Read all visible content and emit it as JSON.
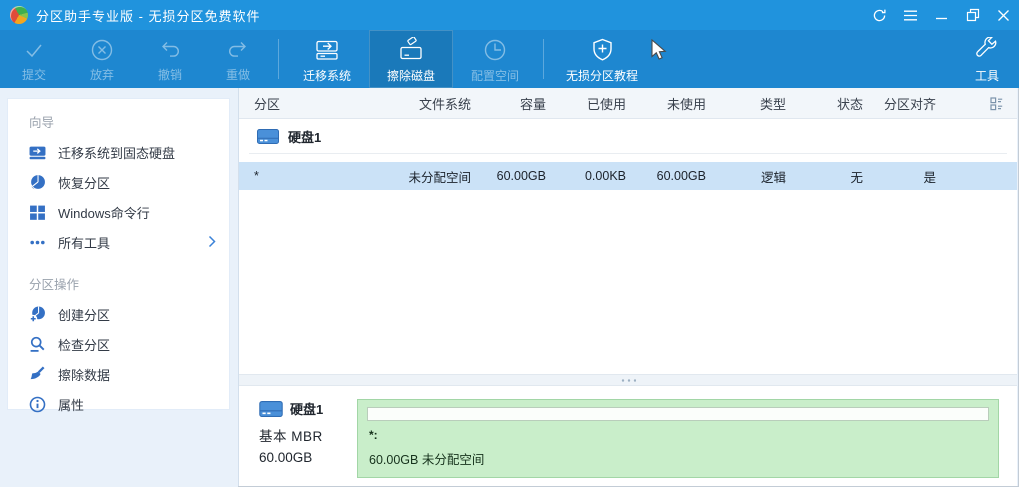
{
  "window": {
    "title": "分区助手专业版 - 无损分区免费软件"
  },
  "toolbar": {
    "buttons": [
      {
        "label": "提交",
        "state": "disabled"
      },
      {
        "label": "放弃",
        "state": "disabled"
      },
      {
        "label": "撤销",
        "state": "disabled"
      },
      {
        "label": "重做",
        "state": "disabled"
      },
      {
        "label": "迁移系统",
        "state": "enabled"
      },
      {
        "label": "擦除磁盘",
        "state": "highlighted"
      },
      {
        "label": "配置空间",
        "state": "disabled"
      },
      {
        "label": "无损分区教程",
        "state": "enabled"
      },
      {
        "label": "工具",
        "state": "enabled"
      }
    ]
  },
  "sidebar": {
    "sections": [
      {
        "title": "向导",
        "items": [
          {
            "label": "迁移系统到固态硬盘"
          },
          {
            "label": "恢复分区"
          },
          {
            "label": "Windows命令行"
          },
          {
            "label": "所有工具"
          }
        ]
      },
      {
        "title": "分区操作",
        "items": [
          {
            "label": "创建分区"
          },
          {
            "label": "检查分区"
          },
          {
            "label": "擦除数据"
          },
          {
            "label": "属性"
          }
        ]
      }
    ]
  },
  "table": {
    "headers": [
      "分区",
      "文件系统",
      "容量",
      "已使用",
      "未使用",
      "类型",
      "状态",
      "分区对齐"
    ],
    "disk_group": {
      "name": "硬盘1"
    },
    "rows": [
      {
        "partition": "*",
        "file_system": "未分配空间",
        "capacity": "60.00GB",
        "used": "0.00KB",
        "unused": "60.00GB",
        "type": "逻辑",
        "status": "无",
        "aligned": "是"
      }
    ]
  },
  "disk_panel": {
    "name": "硬盘1",
    "disk_type": "基本 MBR",
    "size": "60.00GB",
    "block_title": "*:",
    "block_subtitle": "60.00GB 未分配空间"
  },
  "colors": {
    "titlebar": "#2093dd",
    "toolbar": "#1e87d0",
    "selection": "#cbe2f7",
    "unallocated_fill": "#c9eeca",
    "sidebar_bg": "#e9f1fa",
    "accent_blue": "#3470c4"
  }
}
